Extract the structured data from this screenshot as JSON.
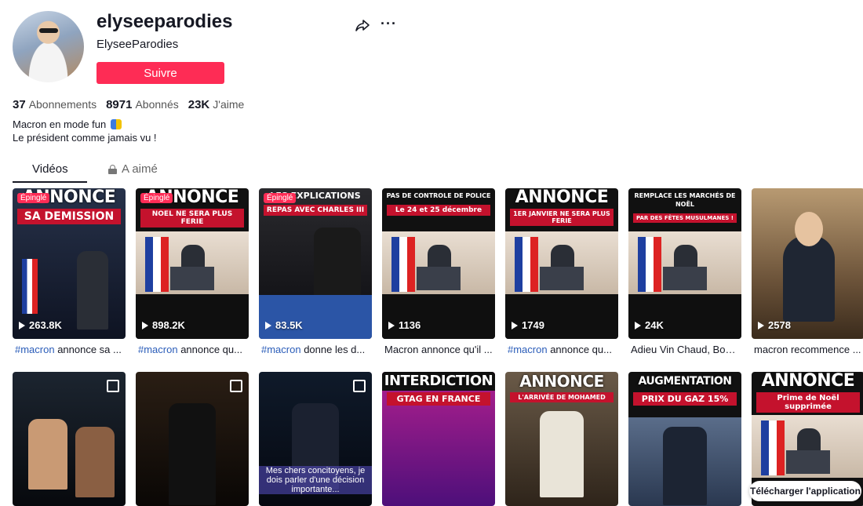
{
  "profile": {
    "username": "elyseeparodies",
    "nickname": "ElyseeParodies",
    "follow_label": "Suivre",
    "stats": [
      {
        "value": "37",
        "label": "Abonnements"
      },
      {
        "value": "8971",
        "label": "Abonnés"
      },
      {
        "value": "23K",
        "label": "J'aime"
      }
    ],
    "bio_line1": "Macron en mode fun",
    "bio_line2": "Le président comme jamais vu !"
  },
  "tabs": {
    "videos": "Vidéos",
    "liked": "A aimé"
  },
  "pinned_label": "Épinglé",
  "videos": [
    {
      "views": "263.8K",
      "tag": "#macron",
      "caption": " annonce sa ...",
      "headline": "ANNONCE",
      "sub": "SA DEMISSION"
    },
    {
      "views": "898.2K",
      "tag": "#macron",
      "caption": " annonce qu...",
      "headline": "ANNONCE",
      "sub": "NOEL NE SERA PLUS FERIE"
    },
    {
      "views": "83.5K",
      "tag": "#macron",
      "caption": " donne les d...",
      "headline": "LES EXPLICATIONS",
      "sub": "REPAS AVEC CHARLES III"
    },
    {
      "views": "1136",
      "tag": "",
      "caption": "Macron annonce qu'il ...",
      "headline": "PAS DE CONTROLE DE POLICE",
      "sub": "Le 24 et 25 décembre"
    },
    {
      "views": "1749",
      "tag": "#macron",
      "caption": " annonce qu...",
      "headline": "ANNONCE",
      "sub": "1ER JANVIER NE SERA PLUS FERIE"
    },
    {
      "views": "24K",
      "tag": "",
      "caption": "Adieu Vin Chaud, Bonj...",
      "headline": "REMPLACE LES MARCHÉS DE NOËL",
      "sub": "PAR DES FÊTES MUSULMANES !"
    },
    {
      "views": "2578",
      "tag": "",
      "caption": "macron recommence ...",
      "headline": "",
      "sub": ""
    }
  ],
  "row2": [
    {
      "headline": "",
      "sub": ""
    },
    {
      "headline": "",
      "sub": ""
    },
    {
      "headline": "",
      "sub": "Mes chers concitoyens, je dois parler d'une décision importante..."
    },
    {
      "headline": "INTERDICTION",
      "sub": "GTAG EN FRANCE"
    },
    {
      "headline": "ANNONCE",
      "sub": "L'ARRIVÉE DE MOHAMED"
    },
    {
      "headline": "AUGMENTATION",
      "sub": "PRIX DU GAZ 15%"
    },
    {
      "headline": "ANNONCE",
      "sub": "Prime de Noël supprimée"
    }
  ],
  "download_label": "Télécharger l'application",
  "icons": {
    "share": "share-icon",
    "more": "more-icon",
    "lock": "lock-icon",
    "play": "play-icon",
    "photo": "photo-icon"
  },
  "colors": {
    "accent": "#fe2c55",
    "hashtag": "#2b5db9"
  }
}
